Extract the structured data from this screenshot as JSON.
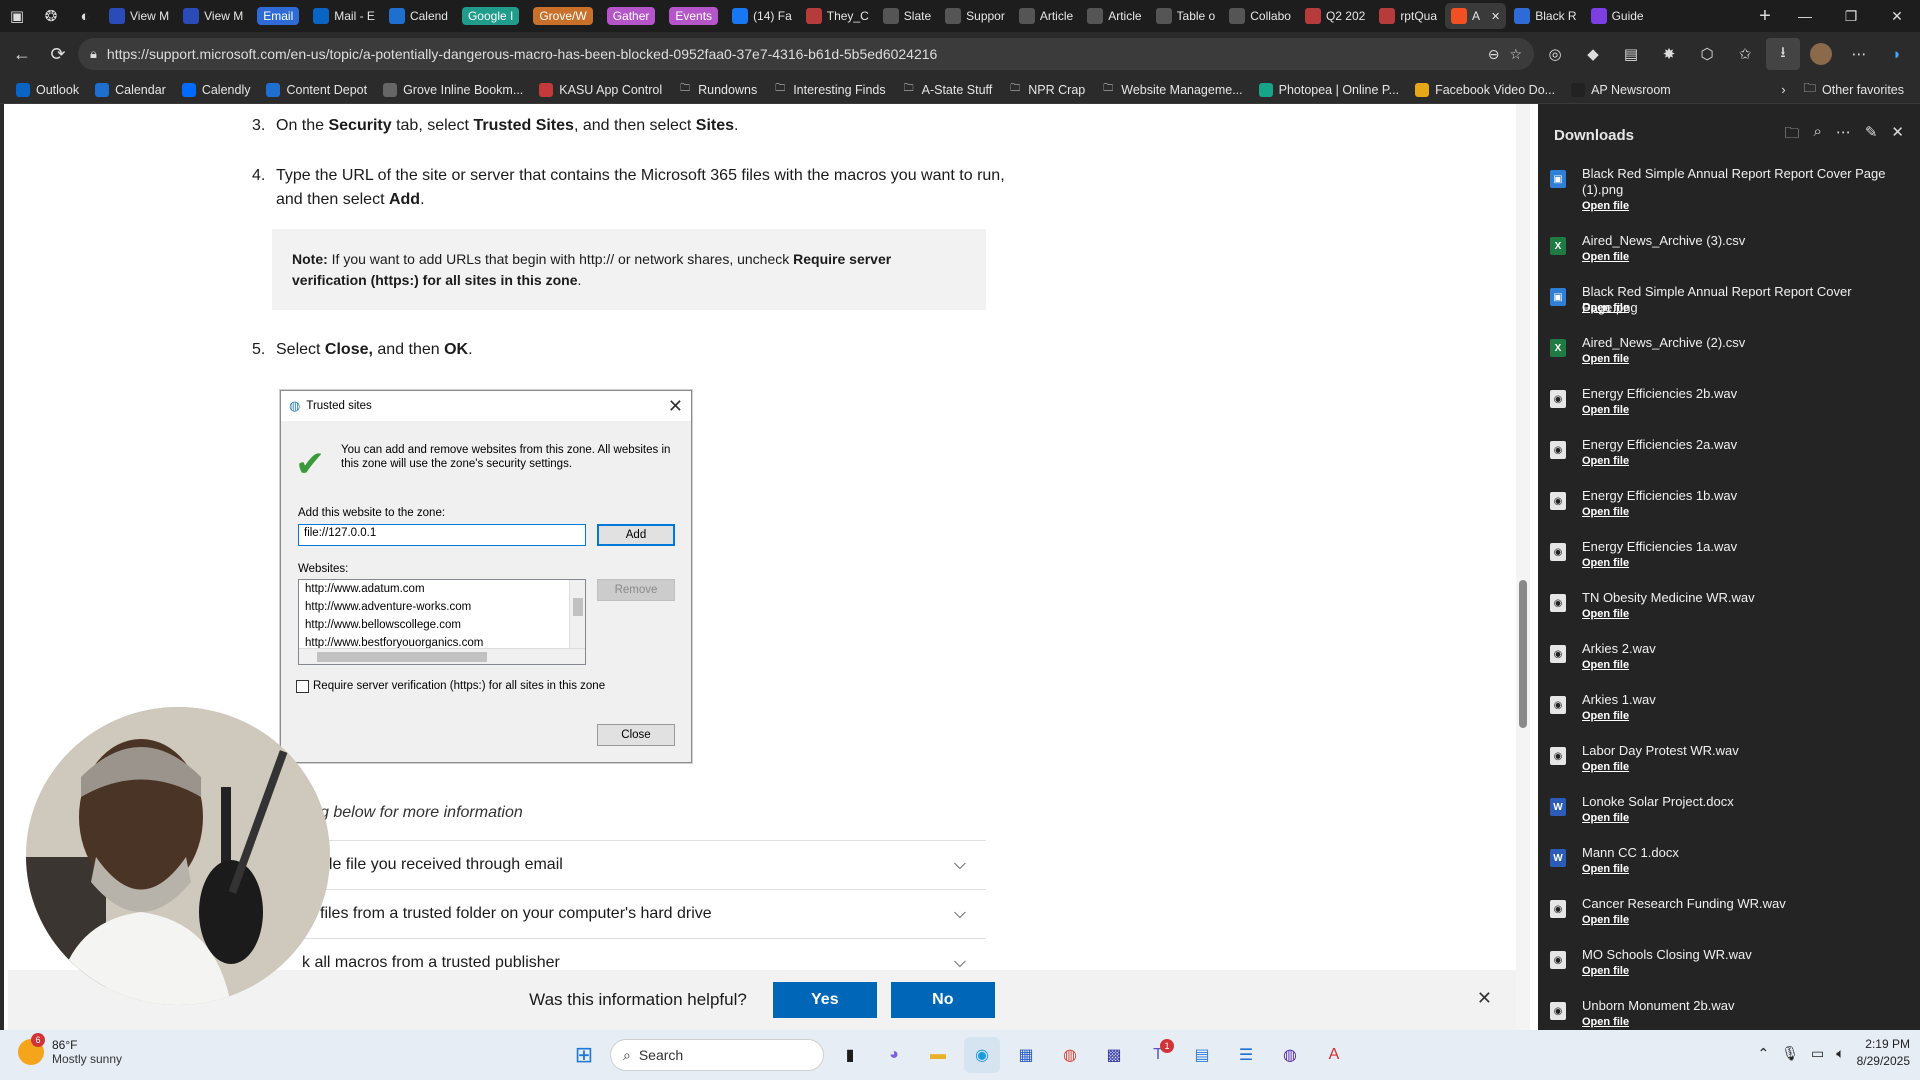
{
  "browser": {
    "tabs": [
      {
        "label": "View M",
        "icon": "outlook-icon",
        "color": "#2b4bb8"
      },
      {
        "label": "View M",
        "icon": "outlook-icon",
        "color": "#2b4bb8"
      },
      {
        "label": "Email",
        "group": true,
        "color": "#2f6bd6"
      },
      {
        "label": "Mail - E",
        "icon": "outlook-icon",
        "color": "#0a64c4"
      },
      {
        "label": "Calend",
        "icon": "calendar-icon",
        "color": "#1f6fd1"
      },
      {
        "label": "Google I",
        "group": true,
        "color": "#1f9c8b"
      },
      {
        "label": "Grove/W",
        "group": true,
        "color": "#c9702a"
      },
      {
        "label": "Gather",
        "group": true,
        "color": "#b455c9"
      },
      {
        "label": "Events",
        "group": true,
        "color": "#b455c9"
      },
      {
        "label": "(14) Fa",
        "icon": "facebook-icon",
        "color": "#1877f2"
      },
      {
        "label": "They_C",
        "icon": "pdf-icon",
        "color": "#b83b3b"
      },
      {
        "label": "Slate",
        "icon": "slate-icon",
        "color": "#555"
      },
      {
        "label": "Suppor",
        "icon": "dots-icon",
        "color": "#555"
      },
      {
        "label": "Article",
        "icon": "dots-icon",
        "color": "#555"
      },
      {
        "label": "Article",
        "icon": "dots-icon",
        "color": "#555"
      },
      {
        "label": "Table o",
        "icon": "dots-icon",
        "color": "#555"
      },
      {
        "label": "Collabo",
        "icon": "dots-icon",
        "color": "#555"
      },
      {
        "label": "Q2 202",
        "icon": "pdf-icon",
        "color": "#b83b3b"
      },
      {
        "label": "rptQua",
        "icon": "pdf-icon",
        "color": "#b83b3b"
      },
      {
        "label": "A",
        "icon": "microsoft-icon",
        "color": "#f25022",
        "active": true
      },
      {
        "label": "Black R",
        "icon": "copilot-icon",
        "color": "#2f6bd6"
      },
      {
        "label": "Guide",
        "icon": "google-icon",
        "color": "#7b3fe4"
      }
    ],
    "url": "https://support.microsoft.com/en-us/topic/a-potentially-dangerous-macro-has-been-blocked-0952faa0-37e7-4316-b61d-5b5ed6024216",
    "favorites": [
      {
        "label": "Outlook",
        "color": "#0a64c4"
      },
      {
        "label": "Calendar",
        "color": "#1f6fd1"
      },
      {
        "label": "Calendly",
        "color": "#006bff"
      },
      {
        "label": "Content Depot",
        "color": "#1f6fd1"
      },
      {
        "label": "Grove Inline Bookm...",
        "color": "#666"
      },
      {
        "label": "KASU App Control",
        "color": "#c43a3a"
      },
      {
        "label": "Rundowns",
        "folder": true
      },
      {
        "label": "Interesting Finds",
        "folder": true
      },
      {
        "label": "A-State Stuff",
        "folder": true
      },
      {
        "label": "NPR Crap",
        "folder": true
      },
      {
        "label": "Website Manageme...",
        "folder": true
      },
      {
        "label": "Photopea | Online P...",
        "color": "#17a589"
      },
      {
        "label": "Facebook Video Do...",
        "color": "#e6a817"
      },
      {
        "label": "AP Newsroom",
        "color": "#222"
      }
    ],
    "other_favorites": "Other favorites"
  },
  "article": {
    "step3": {
      "num": "3.",
      "pre": "On the ",
      "b1": "Security",
      "mid1": " tab, select ",
      "b2": "Trusted Sites",
      "mid2": ", and then select ",
      "b3": "Sites",
      "end": "."
    },
    "step4": {
      "num": "4.",
      "pre": "Type the URL of the site or server that contains the Microsoft 365 files with the macros you want to run, and then select ",
      "b1": "Add",
      "end": "."
    },
    "note": {
      "label": "Note:",
      "pre": " If you want to add URLs that begin with http:// or network shares, uncheck ",
      "b1": "Require server verification (https:) for all sites in this zone",
      "end": "."
    },
    "step5": {
      "num": "5.",
      "pre": "Select ",
      "b1": "Close,",
      "mid": " and then ",
      "b2": "OK",
      "end": "."
    },
    "partial_text": "g below for more information",
    "accordion": [
      "gle file you received through email",
      "files from a trusted folder on your computer's hard drive",
      "k all macros from a trusted publisher"
    ]
  },
  "dialog": {
    "title": "Trusted sites",
    "info": "You can add and remove websites from this zone. All websites in this zone will use the zone's security settings.",
    "add_label": "Add this website to the zone:",
    "input_value": "file://127.0.0.1",
    "add_button": "Add",
    "websites_label": "Websites:",
    "websites": [
      "http://www.adatum.com",
      "http://www.adventure-works.com",
      "http://www.bellowscollege.com",
      "http://www.bestforyouorganics.com"
    ],
    "remove_button": "Remove",
    "checkbox_label": "Require server verification (https:) for all sites in this zone",
    "checkbox_checked": false,
    "close_button": "Close"
  },
  "feedback": {
    "question": "Was this information helpful?",
    "yes": "Yes",
    "no": "No"
  },
  "downloads": {
    "title": "Downloads",
    "open_file": "Open file",
    "items": [
      {
        "name": "Black Red Simple Annual Report Report Cover Page (1).png",
        "type": "image"
      },
      {
        "name": "Aired_News_Archive (3).csv",
        "type": "excel"
      },
      {
        "name": "Black Red Simple Annual Report Report Cover Page.png",
        "type": "image"
      },
      {
        "name": "Aired_News_Archive (2).csv",
        "type": "excel"
      },
      {
        "name": "Energy Efficiencies 2b.wav",
        "type": "audio"
      },
      {
        "name": "Energy Efficiencies 2a.wav",
        "type": "audio"
      },
      {
        "name": "Energy Efficiencies 1b.wav",
        "type": "audio"
      },
      {
        "name": "Energy Efficiencies 1a.wav",
        "type": "audio"
      },
      {
        "name": "TN Obesity Medicine WR.wav",
        "type": "audio"
      },
      {
        "name": "Arkies 2.wav",
        "type": "audio"
      },
      {
        "name": "Arkies 1.wav",
        "type": "audio"
      },
      {
        "name": "Labor Day Protest WR.wav",
        "type": "audio"
      },
      {
        "name": "Lonoke Solar Project.docx",
        "type": "word"
      },
      {
        "name": "Mann CC 1.docx",
        "type": "word"
      },
      {
        "name": "Cancer Research Funding WR.wav",
        "type": "audio"
      },
      {
        "name": "MO Schools Closing WR.wav",
        "type": "audio"
      },
      {
        "name": "Unborn Monument 2b.wav",
        "type": "audio"
      }
    ]
  },
  "taskbar": {
    "weather_temp": "86°F",
    "weather_desc": "Mostly sunny",
    "weather_badge": "6",
    "search_placeholder": "Search",
    "teams_badge": "1",
    "time": "2:19 PM",
    "date": "8/29/2025"
  }
}
